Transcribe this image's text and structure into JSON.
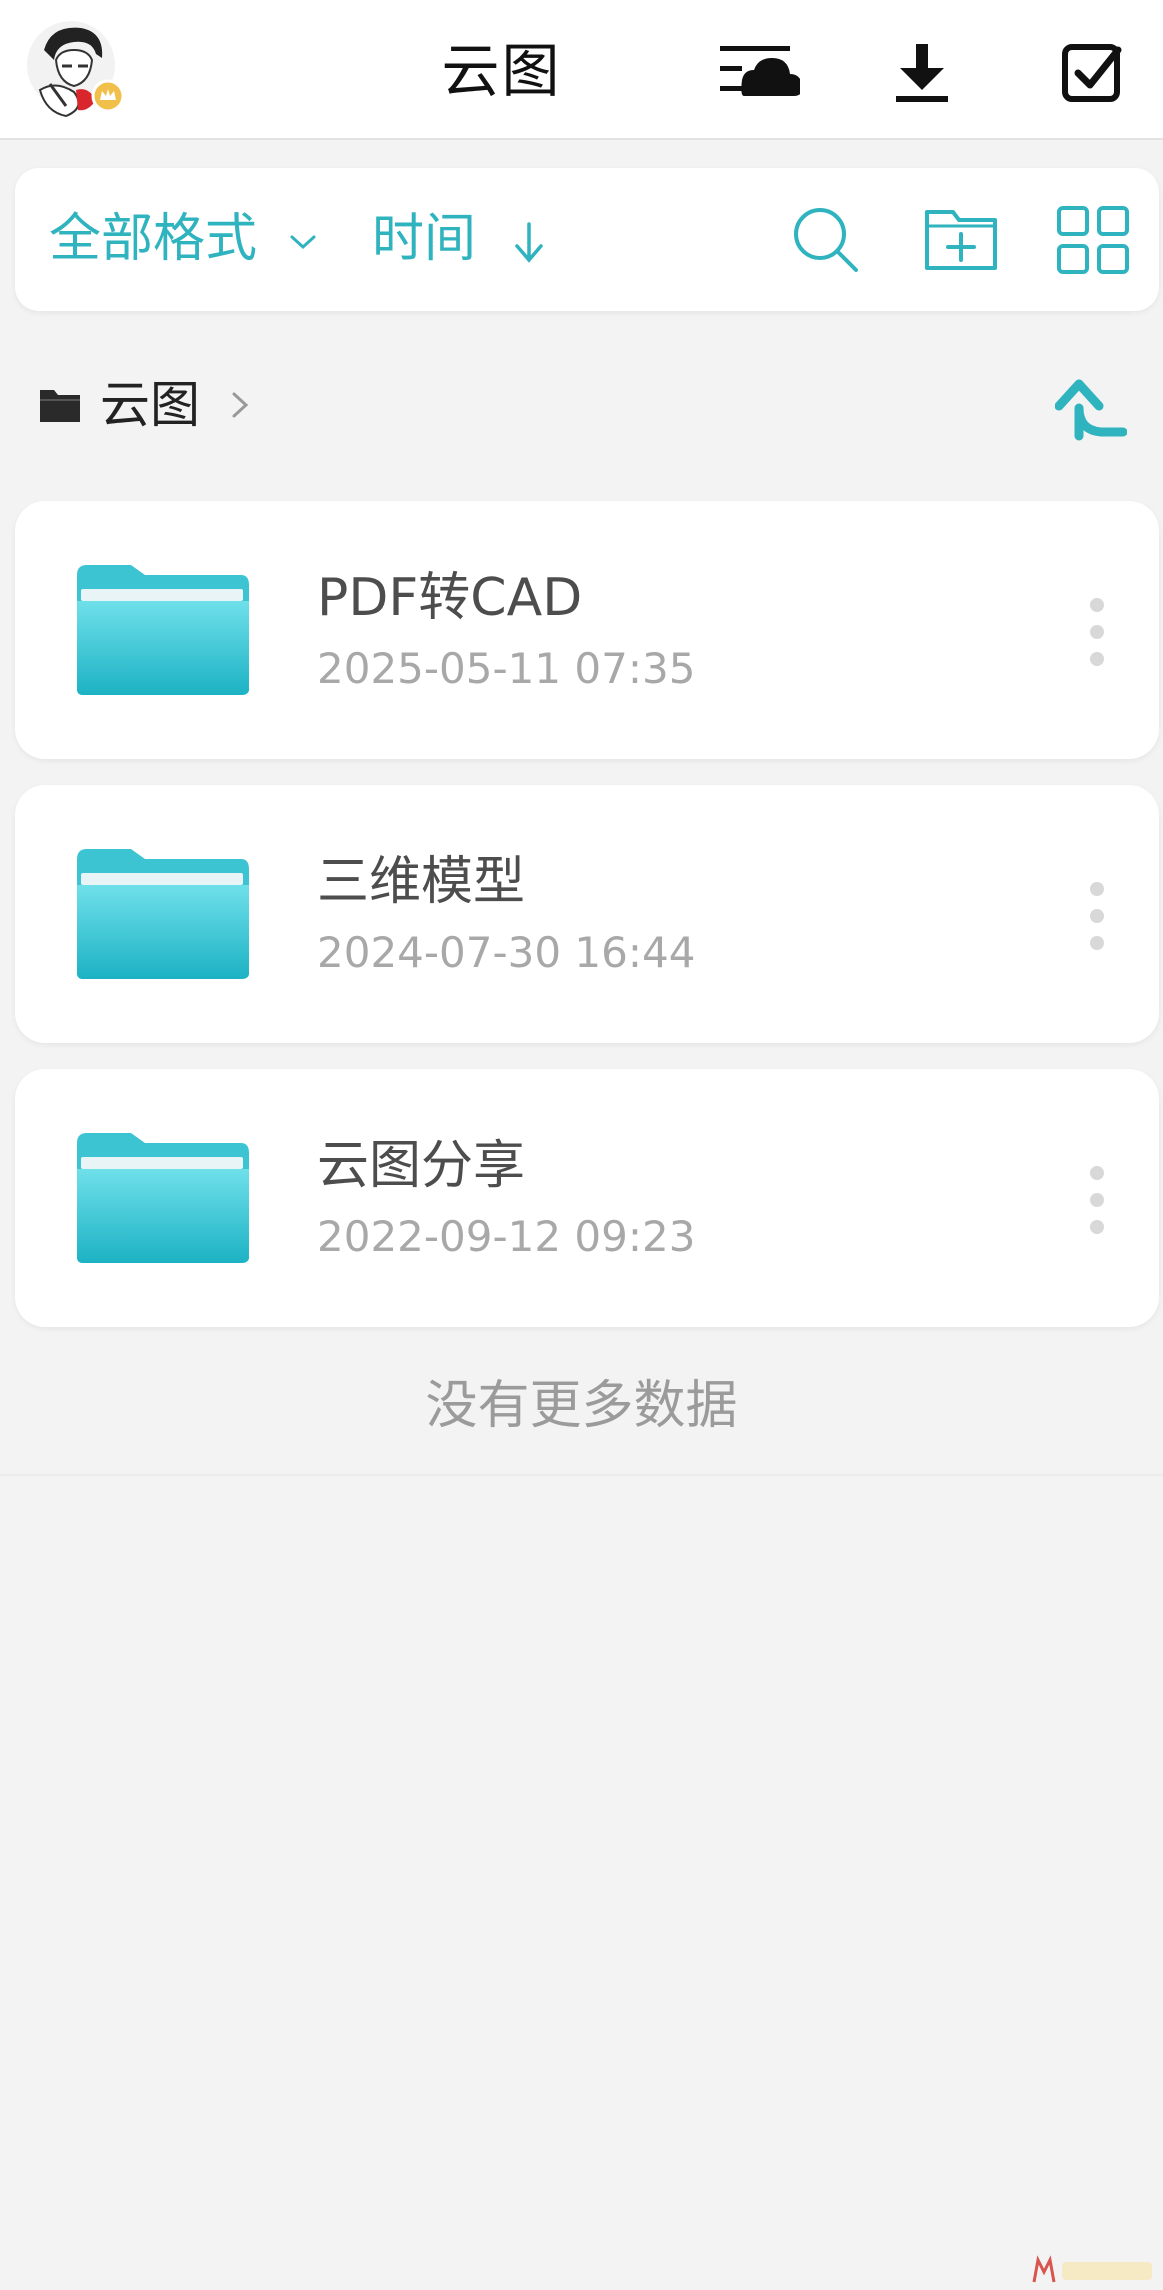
{
  "header": {
    "title": "云图"
  },
  "toolbar": {
    "format_filter_label": "全部格式",
    "sort_label": "时间",
    "accent_color": "#2fb3be"
  },
  "breadcrumb": {
    "current": "云图"
  },
  "files": [
    {
      "name": "PDF转CAD",
      "date": "2025-05-11 07:35",
      "icon": "folder-icon"
    },
    {
      "name": "三维模型",
      "date": "2024-07-30 16:44",
      "icon": "folder-icon"
    },
    {
      "name": "云图分享",
      "date": "2022-09-12 09:23",
      "icon": "folder-icon"
    }
  ],
  "footer": {
    "no_more_text": "没有更多数据"
  }
}
